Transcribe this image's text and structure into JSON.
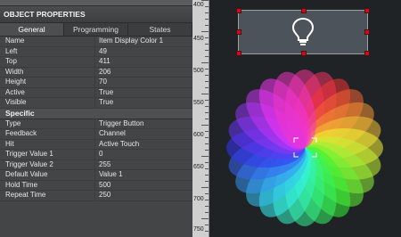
{
  "panel": {
    "title": "OBJECT PROPERTIES",
    "tabs": [
      "General",
      "Programming",
      "States"
    ],
    "general": [
      {
        "k": "Name",
        "v": "Item Display Color 1"
      },
      {
        "k": "Left",
        "v": "49"
      },
      {
        "k": "Top",
        "v": "411"
      },
      {
        "k": "Width",
        "v": "206"
      },
      {
        "k": "Height",
        "v": "70"
      },
      {
        "k": "Active",
        "v": "True"
      },
      {
        "k": "Visible",
        "v": "True"
      }
    ],
    "specific_label": "Specific",
    "specific": [
      {
        "k": "Type",
        "v": "Trigger Button"
      },
      {
        "k": "Feedback",
        "v": "Channel"
      },
      {
        "k": "Hit",
        "v": "Active Touch"
      },
      {
        "k": "Trigger Value 1",
        "v": "0"
      },
      {
        "k": "Trigger Value 2",
        "v": "255"
      },
      {
        "k": "Default Value",
        "v": "Value 1"
      },
      {
        "k": "Hold Time",
        "v": "500"
      },
      {
        "k": "Repeat Time",
        "v": "250"
      }
    ]
  },
  "ruler": {
    "labels": [
      "400",
      "450",
      "500",
      "550",
      "600",
      "650",
      "700",
      "750"
    ]
  },
  "canvas": {
    "button_icon": "lightbulb-icon",
    "wheel": "color-wheel"
  }
}
